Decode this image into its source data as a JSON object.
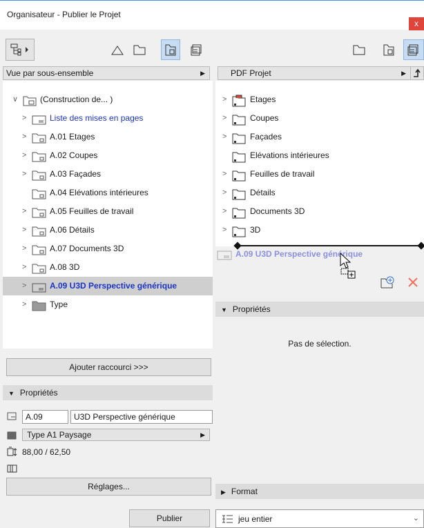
{
  "window": {
    "title": "Organisateur - Publier le Projet",
    "close_glyph": "x"
  },
  "left": {
    "view_selector": "Vue par sous-ensemble",
    "tree": [
      {
        "label": "(Construction de... )",
        "chevron": "∨",
        "style": "normal"
      },
      {
        "label": "Liste des mises en pages",
        "chevron": ">",
        "style": "blue"
      },
      {
        "label": "A.01 Etages",
        "chevron": ">",
        "style": "normal"
      },
      {
        "label": "A.02 Coupes",
        "chevron": ">",
        "style": "normal"
      },
      {
        "label": "A.03 Façades",
        "chevron": ">",
        "style": "normal"
      },
      {
        "label": "A.04 Elévations intérieures",
        "chevron": "",
        "style": "normal"
      },
      {
        "label": "A.05 Feuilles de travail",
        "chevron": ">",
        "style": "normal"
      },
      {
        "label": "A.06 Détails",
        "chevron": ">",
        "style": "normal"
      },
      {
        "label": "A.07 Documents 3D",
        "chevron": ">",
        "style": "normal"
      },
      {
        "label": "A.08 3D",
        "chevron": ">",
        "style": "normal"
      },
      {
        "label": "A.09 U3D Perspective générique",
        "chevron": ">",
        "style": "selected"
      },
      {
        "label": "Type",
        "chevron": ">",
        "style": "normal"
      }
    ],
    "add_shortcut_button": "Ajouter raccourci >>>",
    "properties_header": "Propriétés",
    "properties": {
      "id_value": "A.09",
      "name_value": "U3D Perspective générique",
      "type_value": "Type A1 Paysage",
      "size_text": "88,00 / 62,50"
    },
    "settings_button": "Réglages...",
    "publish_button": "Publier"
  },
  "right": {
    "set_selector": "PDF Projet",
    "tree": [
      {
        "label": "Etages",
        "chevron": ">"
      },
      {
        "label": "Coupes",
        "chevron": ">"
      },
      {
        "label": "Façades",
        "chevron": ">"
      },
      {
        "label": "Elévations intérieures",
        "chevron": ""
      },
      {
        "label": "Feuilles de travail",
        "chevron": ">"
      },
      {
        "label": "Détails",
        "chevron": ">"
      },
      {
        "label": "Documents 3D",
        "chevron": ">"
      },
      {
        "label": "3D",
        "chevron": ">"
      }
    ],
    "drag_label": "A.09 U3D Perspective générique",
    "properties_header": "Propriétés",
    "no_selection": "Pas de sélection.",
    "format_header": "Format",
    "scope_selector": "jeu entier"
  },
  "colors": {
    "selection_blue": "#1b35c9",
    "drag_blue": "#8c8fe6",
    "close_red": "#e0453b",
    "delete_red": "#f07060",
    "active_tool": "#c7dcf3"
  }
}
